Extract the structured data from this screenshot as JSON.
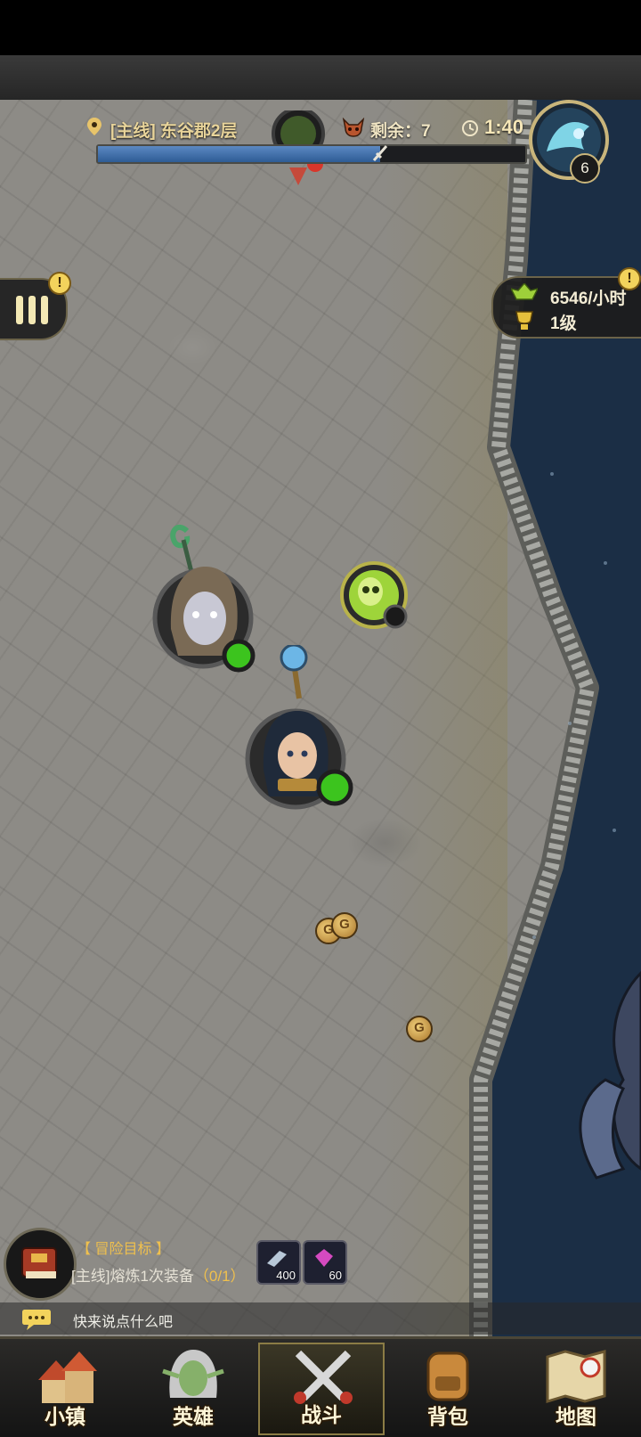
{
  "hud": {
    "quest_location": "[主线] 东谷郡2层",
    "remaining_label": "剩余：7",
    "timer": "1:40",
    "boss_level": "6",
    "progress_fraction": 0.66
  },
  "alerts": {
    "menu_badge": "!",
    "income_badge": "!"
  },
  "income": {
    "rate": "6546/小时",
    "level": "1级"
  },
  "objective": {
    "title": "【 冒险目标 】",
    "description": "[主线]熔炼1次装备",
    "progress": "（0/1）",
    "rewards": [
      {
        "icon": "scroll-reward-icon",
        "count": "400"
      },
      {
        "icon": "gem-reward-icon",
        "count": "60"
      }
    ]
  },
  "chat": {
    "placeholder": "快来说点什么吧"
  },
  "nav": {
    "tabs": [
      {
        "label": "小镇",
        "icon": "town-icon"
      },
      {
        "label": "英雄",
        "icon": "hero-icon"
      },
      {
        "label": "战斗",
        "icon": "battle-icon",
        "active": true
      },
      {
        "label": "背包",
        "icon": "backpack-icon"
      },
      {
        "label": "地图",
        "icon": "map-icon"
      }
    ]
  },
  "colors": {
    "accent": "#f0c04d",
    "progress": "#4b78b3",
    "water": "#1b2e45",
    "ground": "#8d8b86"
  }
}
